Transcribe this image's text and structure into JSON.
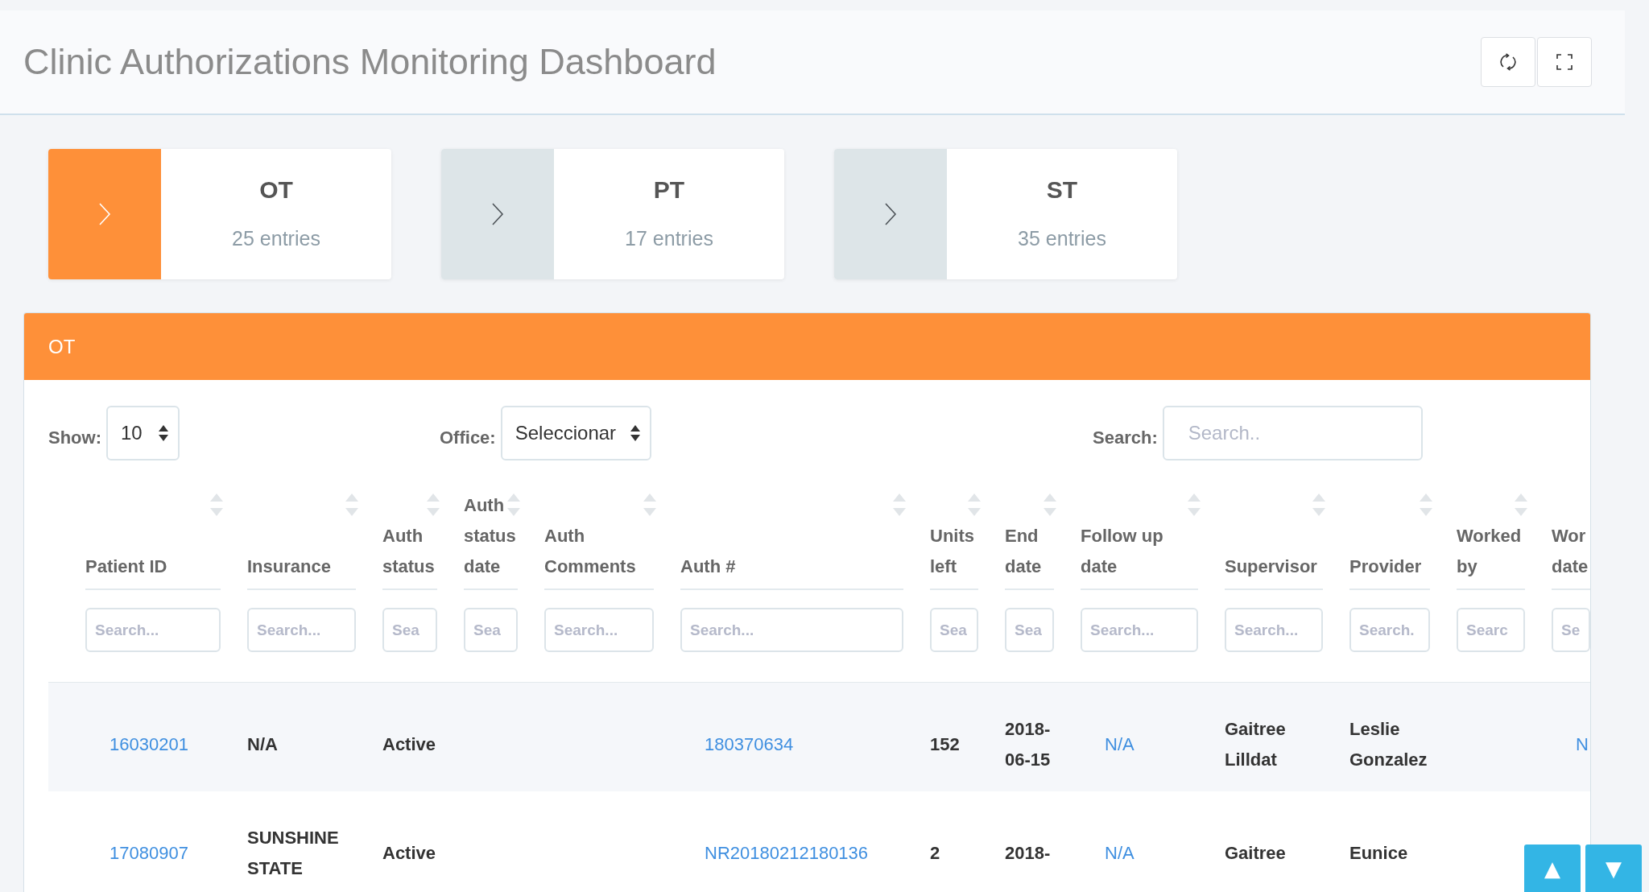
{
  "header": {
    "title": "Clinic Authorizations Monitoring Dashboard"
  },
  "cards": [
    {
      "title": "OT",
      "count": "25 entries",
      "selected": true
    },
    {
      "title": "PT",
      "count": "17 entries",
      "selected": false
    },
    {
      "title": "ST",
      "count": "35 entries",
      "selected": false
    }
  ],
  "panel": {
    "title": "OT",
    "show": {
      "label": "Show:",
      "value": "10"
    },
    "office": {
      "label": "Office:",
      "value": "Seleccionar"
    },
    "search": {
      "label": "Search:",
      "placeholder": "Search.."
    }
  },
  "table": {
    "columns": [
      {
        "label": "Patient ID",
        "placeholder": "Search..."
      },
      {
        "label": "Insurance",
        "placeholder": "Search..."
      },
      {
        "label": "Auth status",
        "placeholder": "Sea"
      },
      {
        "label": "Auth status date",
        "placeholder": "Sea"
      },
      {
        "label": "Auth Comments",
        "placeholder": "Search..."
      },
      {
        "label": "Auth #",
        "placeholder": "Search..."
      },
      {
        "label": "Units left",
        "placeholder": "Sea"
      },
      {
        "label": "End date",
        "placeholder": "Sea"
      },
      {
        "label": "Follow up date",
        "placeholder": "Search..."
      },
      {
        "label": "Supervisor",
        "placeholder": "Search..."
      },
      {
        "label": "Provider",
        "placeholder": "Search."
      },
      {
        "label": "Worked by",
        "placeholder": "Searc"
      },
      {
        "label": "Wor date",
        "placeholder": "Se"
      }
    ],
    "rows": [
      [
        {
          "text": "16030201",
          "kind": "link"
        },
        {
          "text": "N/A",
          "kind": "text"
        },
        {
          "text": "Active",
          "kind": "text"
        },
        null,
        null,
        {
          "text": "180370634",
          "kind": "link"
        },
        {
          "text": "152",
          "kind": "text"
        },
        {
          "text": "2018-06-15",
          "kind": "text"
        },
        {
          "text": "N/A",
          "kind": "link"
        },
        {
          "text": "Gaitree Lilldat",
          "kind": "text"
        },
        {
          "text": "Leslie Gonzalez",
          "kind": "text"
        },
        null,
        {
          "text": "N",
          "kind": "link"
        }
      ],
      [
        {
          "text": "17080907",
          "kind": "link"
        },
        {
          "text": "SUNSHINE STATE",
          "kind": "text"
        },
        {
          "text": "Active",
          "kind": "text"
        },
        null,
        null,
        {
          "text": "NR20180212180136",
          "kind": "link"
        },
        {
          "text": "2",
          "kind": "text"
        },
        {
          "text": "2018-",
          "kind": "text"
        },
        {
          "text": "N/A",
          "kind": "link"
        },
        {
          "text": "Gaitree",
          "kind": "text"
        },
        {
          "text": "Eunice",
          "kind": "text"
        },
        null,
        null
      ]
    ]
  },
  "scroll_buttons": [
    {
      "label": "▲"
    },
    {
      "label": "▼"
    }
  ]
}
